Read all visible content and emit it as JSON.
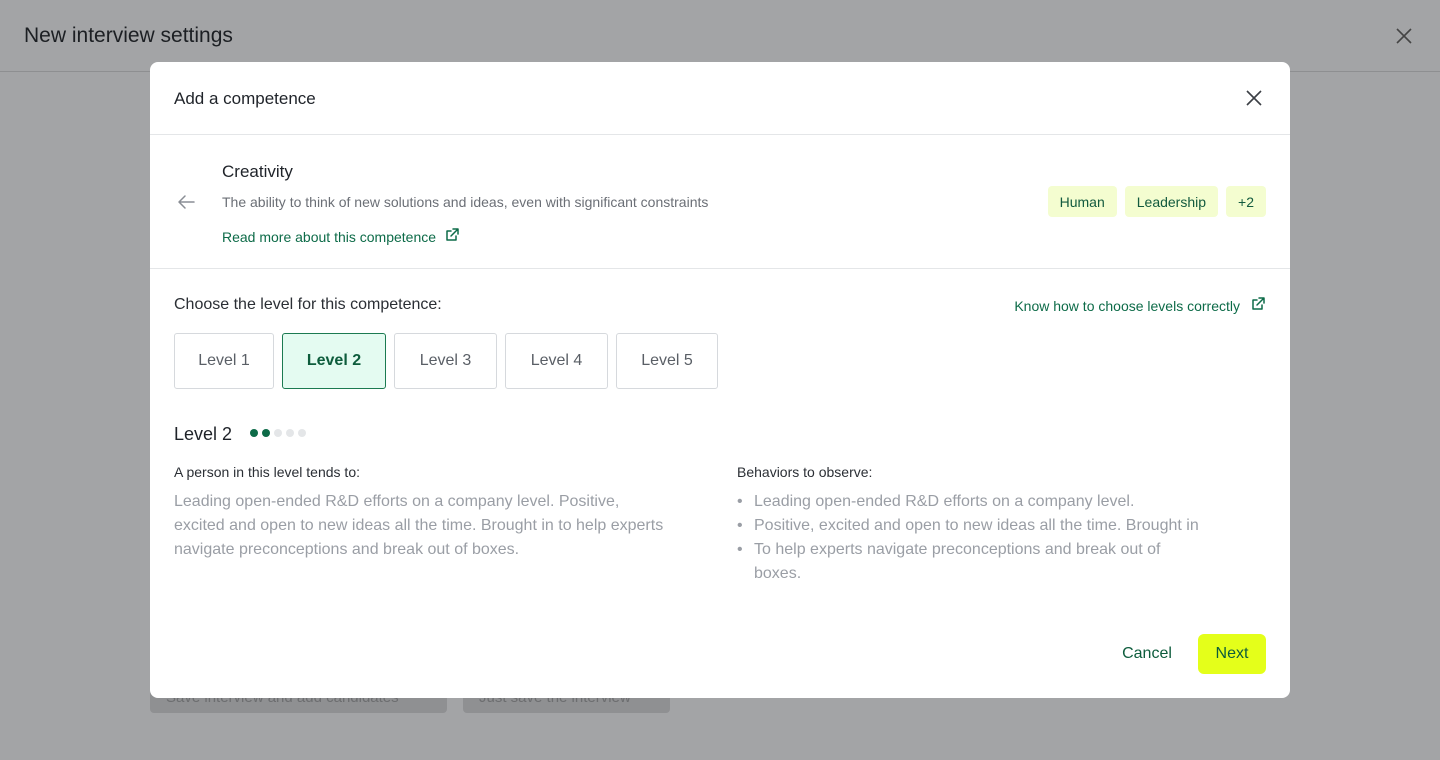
{
  "background": {
    "page_title": "New interview settings",
    "button_1": "Save interview and add candidates",
    "button_2": "Just save the interview"
  },
  "modal": {
    "title": "Add a competence",
    "competence": {
      "name": "Creativity",
      "description": "The ability to think of new solutions and ideas, even with significant constraints",
      "read_more": "Read more about this competence",
      "tags": [
        "Human",
        "Leadership",
        "+2"
      ]
    },
    "choose_label": "Choose the level for this competence:",
    "know_link": "Know how to choose levels correctly",
    "levels": [
      "Level 1",
      "Level 2",
      "Level 3",
      "Level 4",
      "Level 5"
    ],
    "selected_level": 2,
    "level_detail": {
      "title": "Level 2",
      "dots_total": 5,
      "dots_filled": 2,
      "tends_heading": "A person in this level tends to:",
      "tends_text": "Leading open-ended R&D efforts on a company level. Positive, excited and open to new ideas all the time. Brought in to help experts navigate preconceptions and break out of boxes.",
      "behaviors_heading": "Behaviors to observe:",
      "behaviors": [
        "Leading open-ended R&D efforts on a company level.",
        "Positive, excited and open to new ideas all the time. Brought in",
        "To help experts navigate preconceptions and break out of boxes."
      ]
    },
    "cancel_label": "Cancel",
    "next_label": "Next"
  },
  "colors": {
    "accent_green": "#0d6b48",
    "next_button": "#e4ff1a",
    "tag_bg": "#f4fdd0",
    "selected_level_bg": "#e4fbf1"
  }
}
